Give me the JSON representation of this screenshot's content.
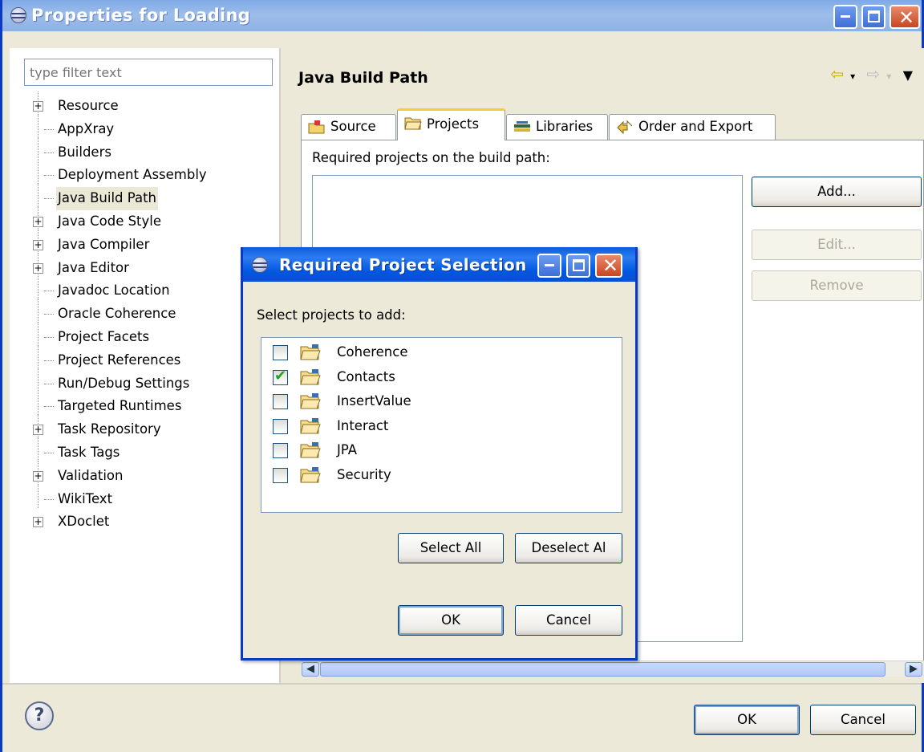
{
  "window": {
    "title": "Properties for Loading",
    "filter_placeholder": "type filter text",
    "tree": [
      {
        "label": "Resource",
        "expandable": true
      },
      {
        "label": "AppXray",
        "expandable": false
      },
      {
        "label": "Builders",
        "expandable": false
      },
      {
        "label": "Deployment Assembly",
        "expandable": false
      },
      {
        "label": "Java Build Path",
        "expandable": false,
        "selected": true
      },
      {
        "label": "Java Code Style",
        "expandable": true
      },
      {
        "label": "Java Compiler",
        "expandable": true
      },
      {
        "label": "Java Editor",
        "expandable": true
      },
      {
        "label": "Javadoc Location",
        "expandable": false
      },
      {
        "label": "Oracle Coherence",
        "expandable": false
      },
      {
        "label": "Project Facets",
        "expandable": false
      },
      {
        "label": "Project References",
        "expandable": false
      },
      {
        "label": "Run/Debug Settings",
        "expandable": false
      },
      {
        "label": "Targeted Runtimes",
        "expandable": false
      },
      {
        "label": "Task Repository",
        "expandable": true
      },
      {
        "label": "Task Tags",
        "expandable": false
      },
      {
        "label": "Validation",
        "expandable": true
      },
      {
        "label": "WikiText",
        "expandable": false
      },
      {
        "label": "XDoclet",
        "expandable": true
      }
    ],
    "page_title": "Java Build Path",
    "tabs": {
      "source": "Source",
      "projects": "Projects",
      "libraries": "Libraries",
      "order": "Order and Export"
    },
    "required_label": "Required projects on the build path:",
    "buttons": {
      "add": "Add...",
      "edit": "Edit...",
      "remove": "Remove",
      "ok": "OK",
      "cancel": "Cancel"
    },
    "help_glyph": "?"
  },
  "dialog": {
    "title": "Required Project Selection",
    "select_label": "Select projects to add:",
    "projects": [
      {
        "name": "Coherence",
        "checked": false
      },
      {
        "name": "Contacts",
        "checked": true
      },
      {
        "name": "InsertValue",
        "checked": false
      },
      {
        "name": "Interact",
        "checked": false
      },
      {
        "name": "JPA",
        "checked": false
      },
      {
        "name": "Security",
        "checked": false
      }
    ],
    "buttons": {
      "select_all": "Select All",
      "deselect_all": "Deselect Al",
      "ok": "OK",
      "cancel": "Cancel"
    }
  },
  "colors": {
    "tab_active_accent": "#ffc83d",
    "checkmark": "#21a121",
    "xp_title_blue": "#0058e0"
  }
}
